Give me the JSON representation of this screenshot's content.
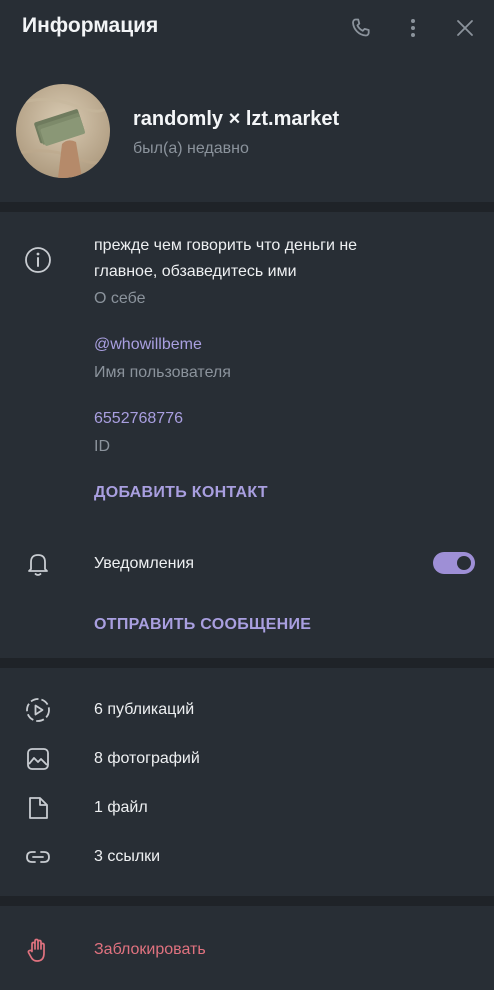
{
  "header": {
    "title": "Информация"
  },
  "profile": {
    "name": "randomly × lzt.market",
    "status": "был(а) недавно"
  },
  "about": {
    "bio_line1": "прежде чем говорить что деньги не",
    "bio_line2": "главное, обзаведитесь ими",
    "bio_label": "О себе",
    "username": "@whowillbeme",
    "username_label": "Имя пользователя",
    "id": "6552768776",
    "id_label": "ID",
    "add_contact": "ДОБАВИТЬ КОНТАКТ"
  },
  "notifications": {
    "label": "Уведомления",
    "enabled": true
  },
  "send_message": "ОТПРАВИТЬ СООБЩЕНИЕ",
  "media": {
    "stories": "6 публикаций",
    "photos": "8 фотографий",
    "files": "1 файл",
    "links": "3 ссылки"
  },
  "block": "Заблокировать",
  "colors": {
    "background": "#282e35",
    "separator": "#1f2328",
    "accent": "#a99fe0",
    "danger": "#e0727f",
    "secondary_text": "#8b939c"
  }
}
